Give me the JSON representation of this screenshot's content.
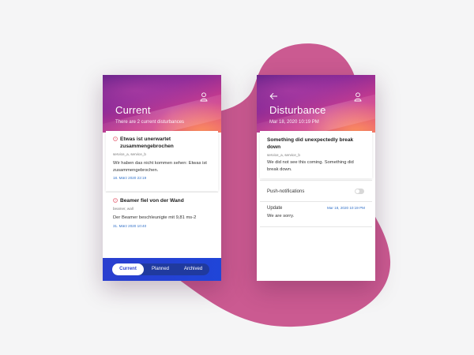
{
  "colors": {
    "blob": "#cb5a91",
    "background": "#f5f5f6",
    "tab_bar": "#2a3fcf",
    "timestamp": "#3070c8",
    "warning": "#e0455a"
  },
  "left_screen": {
    "title": "Current",
    "subtitle": "There are 2 current disturbances",
    "header_icon": "user-icon",
    "disturbances": [
      {
        "icon": "warning-circle-icon",
        "title": "Etwas ist unerwartet zusammengebrochen",
        "tags": "service_a, service_b",
        "body": "Wir haben das nicht kommen sehen: Etwas ist zusammengebrochen.",
        "time": "18. März 2020 22:19"
      },
      {
        "icon": "warning-circle-icon",
        "title": "Beamer fiel von der Wand",
        "tags": "beamer, wall",
        "body": "Der Beamer beschleunigte mit 9,81 ms-2",
        "time": "31. März 2020 10:40"
      }
    ],
    "tabs": [
      "Current",
      "Planned",
      "Archived"
    ],
    "active_tab": "Current"
  },
  "right_screen": {
    "title": "Disturbance",
    "subtitle": "Mar 18, 2020 10:19 PM",
    "back_icon": "arrow-left-icon",
    "header_icon": "user-icon",
    "detail": {
      "title": "Something did unexpectedly break down",
      "tags": "service_a, service_b",
      "body": "We did not see this coming. Something did break down."
    },
    "push_label": "Push-notifications",
    "push_enabled": false,
    "update": {
      "label": "Update",
      "time": "Mar 18, 2020 10:19 PM",
      "text": "We are sorry."
    }
  }
}
